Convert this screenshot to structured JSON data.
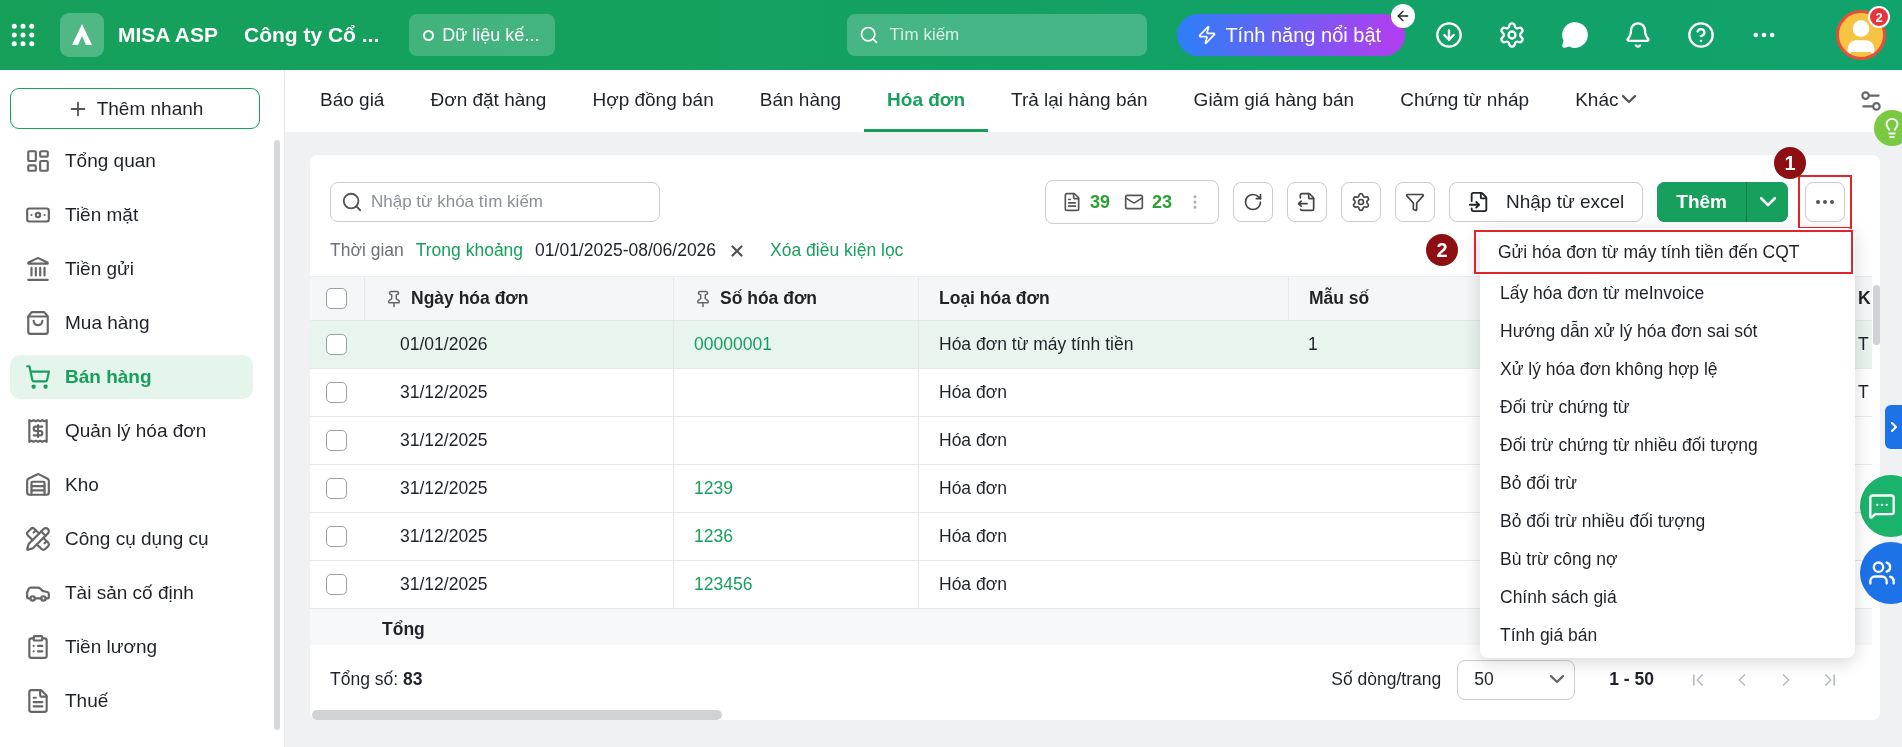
{
  "topbar": {
    "brand": "MISA ASP",
    "company": "Công ty Cổ ...",
    "data_chip": "Dữ liệu kế...",
    "search": {
      "placeholder": "Tìm kiếm"
    },
    "feature_button": "Tính năng nổi bật",
    "notification_count": "2"
  },
  "sidebar": {
    "quick_add": "Thêm nhanh",
    "items": [
      {
        "label": "Tổng quan",
        "selected": false
      },
      {
        "label": "Tiền mặt",
        "selected": false
      },
      {
        "label": "Tiền gửi",
        "selected": false
      },
      {
        "label": "Mua hàng",
        "selected": false
      },
      {
        "label": "Bán hàng",
        "selected": true
      },
      {
        "label": "Quản lý hóa đơn",
        "selected": false
      },
      {
        "label": "Kho",
        "selected": false
      },
      {
        "label": "Công cụ dụng cụ",
        "selected": false
      },
      {
        "label": "Tài sản cố định",
        "selected": false
      },
      {
        "label": "Tiền lương",
        "selected": false
      },
      {
        "label": "Thuế",
        "selected": false
      }
    ]
  },
  "tabs": [
    {
      "label": "Báo giá",
      "selected": false,
      "kind": "tab"
    },
    {
      "label": "Đơn đặt hàng",
      "selected": false,
      "kind": "tab"
    },
    {
      "label": "Hợp đồng bán",
      "selected": false,
      "kind": "tab"
    },
    {
      "label": "Bán hàng",
      "selected": false,
      "kind": "tab"
    },
    {
      "label": "Hóa đơn",
      "selected": true,
      "kind": "tab"
    },
    {
      "label": "Trả lại hàng bán",
      "selected": false,
      "kind": "tab"
    },
    {
      "label": "Giảm giá hàng bán",
      "selected": false,
      "kind": "tab"
    },
    {
      "label": "Chứng từ nháp",
      "selected": false,
      "kind": "tab"
    },
    {
      "label": "Khác",
      "selected": false,
      "kind": "dropdown"
    }
  ],
  "toolbar": {
    "search": {
      "placeholder": "Nhập từ khóa tìm kiếm"
    },
    "counters": [
      "39",
      "23"
    ],
    "import_button": "Nhập từ excel",
    "add_button": "Thêm",
    "more_button": {
      "highlighted": true,
      "marker": "1"
    }
  },
  "filter": {
    "label": "Thời gian",
    "mode": "Trong khoảng",
    "range": "01/01/2025-08/06/2026",
    "clear": "Xóa điều kiện lọc"
  },
  "table": {
    "header_checked": false,
    "columns": [
      {
        "label": "Ngày hóa đơn",
        "pinned": true,
        "kind": "text"
      },
      {
        "label": "Số hóa đơn",
        "pinned": true,
        "kind": "link"
      },
      {
        "label": "Loại hóa đơn",
        "pinned": false,
        "kind": "text"
      },
      {
        "label": "Mẫu số",
        "pinned": false,
        "kind": "text"
      },
      {
        "label": "K",
        "pinned": false,
        "kind": "text"
      }
    ],
    "rows": [
      {
        "selected": true,
        "checked": false,
        "cells": [
          "01/01/2026",
          "00000001",
          "Hóa đơn từ máy tính tiền",
          "1",
          "T"
        ]
      },
      {
        "selected": false,
        "checked": false,
        "cells": [
          "31/12/2025",
          null,
          "Hóa đơn",
          null,
          "T"
        ]
      },
      {
        "selected": false,
        "checked": false,
        "cells": [
          "31/12/2025",
          null,
          "Hóa đơn"
        ]
      },
      {
        "selected": false,
        "checked": false,
        "cells": [
          "31/12/2025",
          "1239",
          "Hóa đơn"
        ]
      },
      {
        "selected": false,
        "checked": false,
        "cells": [
          "31/12/2025",
          "1236",
          "Hóa đơn"
        ]
      },
      {
        "selected": false,
        "checked": false,
        "cells": [
          "31/12/2025",
          "123456",
          "Hóa đơn"
        ]
      }
    ],
    "total_label": "Tổng"
  },
  "footer": {
    "total_label": "Tổng số:",
    "total": "83",
    "page_size_label": "Số dòng/trang",
    "page_size": "50",
    "range": "1 - 50"
  },
  "more_menu": {
    "items": [
      {
        "label": "Gửi hóa đơn từ máy tính tiền đến CQT",
        "highlighted": true,
        "marker": "2"
      },
      {
        "label": "Lấy hóa đơn từ meInvoice",
        "highlighted": false
      },
      {
        "label": "Hướng dẫn xử lý hóa đơn sai sót",
        "highlighted": false
      },
      {
        "label": "Xử lý hóa đơn không hợp lệ",
        "highlighted": false
      },
      {
        "label": "Đối trừ chứng từ",
        "highlighted": false
      },
      {
        "label": "Đối trừ chứng từ nhiều đối tượng",
        "highlighted": false
      },
      {
        "label": "Bỏ đối trừ",
        "highlighted": false
      },
      {
        "label": "Bỏ đối trừ nhiều đối tượng",
        "highlighted": false
      },
      {
        "label": "Bù trừ công nợ",
        "highlighted": false
      },
      {
        "label": "Chính sách giá",
        "highlighted": false
      },
      {
        "label": "Tính giá bán",
        "highlighted": false
      }
    ]
  }
}
